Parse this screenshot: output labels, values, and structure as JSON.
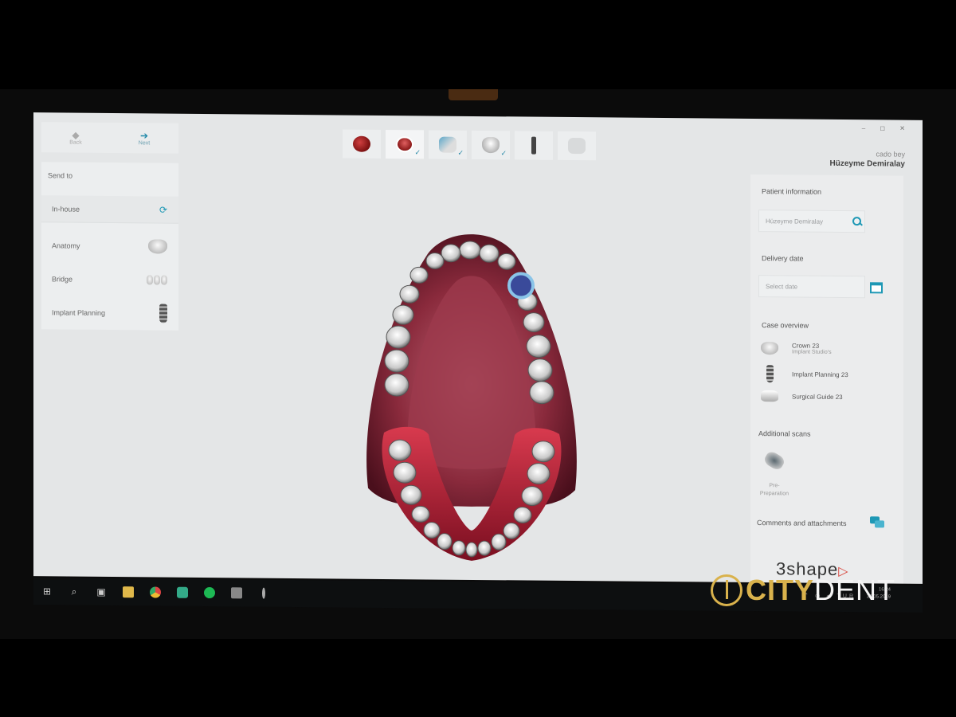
{
  "nav": {
    "back_label": "Back",
    "next_label": "Next"
  },
  "left_panel": {
    "title": "Send to",
    "items": [
      {
        "label": "In-house",
        "icon": "sync-icon"
      },
      {
        "label": "Anatomy",
        "icon": "crown-icon"
      },
      {
        "label": "Bridge",
        "icon": "bridge-icon"
      },
      {
        "label": "Implant Planning",
        "icon": "implant-icon"
      }
    ]
  },
  "toolbar": {
    "steps": [
      {
        "icon": "patient-icon",
        "checked": false
      },
      {
        "icon": "scan-icon",
        "checked": true
      },
      {
        "icon": "design-icon",
        "checked": true
      },
      {
        "icon": "crown-icon",
        "checked": true
      },
      {
        "icon": "implant-icon",
        "checked": false
      },
      {
        "icon": "finish-icon",
        "checked": false
      }
    ]
  },
  "window_controls": "– ◻ ✕",
  "user": {
    "line1": "cado bey",
    "name": "Hüzeyme Demiralay"
  },
  "right_panel": {
    "patient_info_title": "Patient information",
    "patient_name_value": "Hüzeyme Demiralay",
    "delivery_title": "Delivery date",
    "delivery_placeholder": "Select date",
    "case_title": "Case overview",
    "case_items": [
      {
        "label": "Crown 23",
        "sub": "Implant Studio's"
      },
      {
        "label": "Implant Planning 23",
        "sub": ""
      },
      {
        "label": "Surgical Guide 23",
        "sub": ""
      }
    ],
    "additional_title": "Additional scans",
    "pre_prep_label": "Pre-Preparation",
    "comments_label": "Comments and attachments"
  },
  "logo_text": "3shape",
  "taskbar": {
    "time": "16:24",
    "date": "28.05.2019",
    "lang": "TUR"
  },
  "watermark": {
    "part1": "CITY",
    "part2": "DENT"
  },
  "colors": {
    "accent": "#1e98b5",
    "gum": "#8a1a2c",
    "watermark": "#d9b24c"
  }
}
